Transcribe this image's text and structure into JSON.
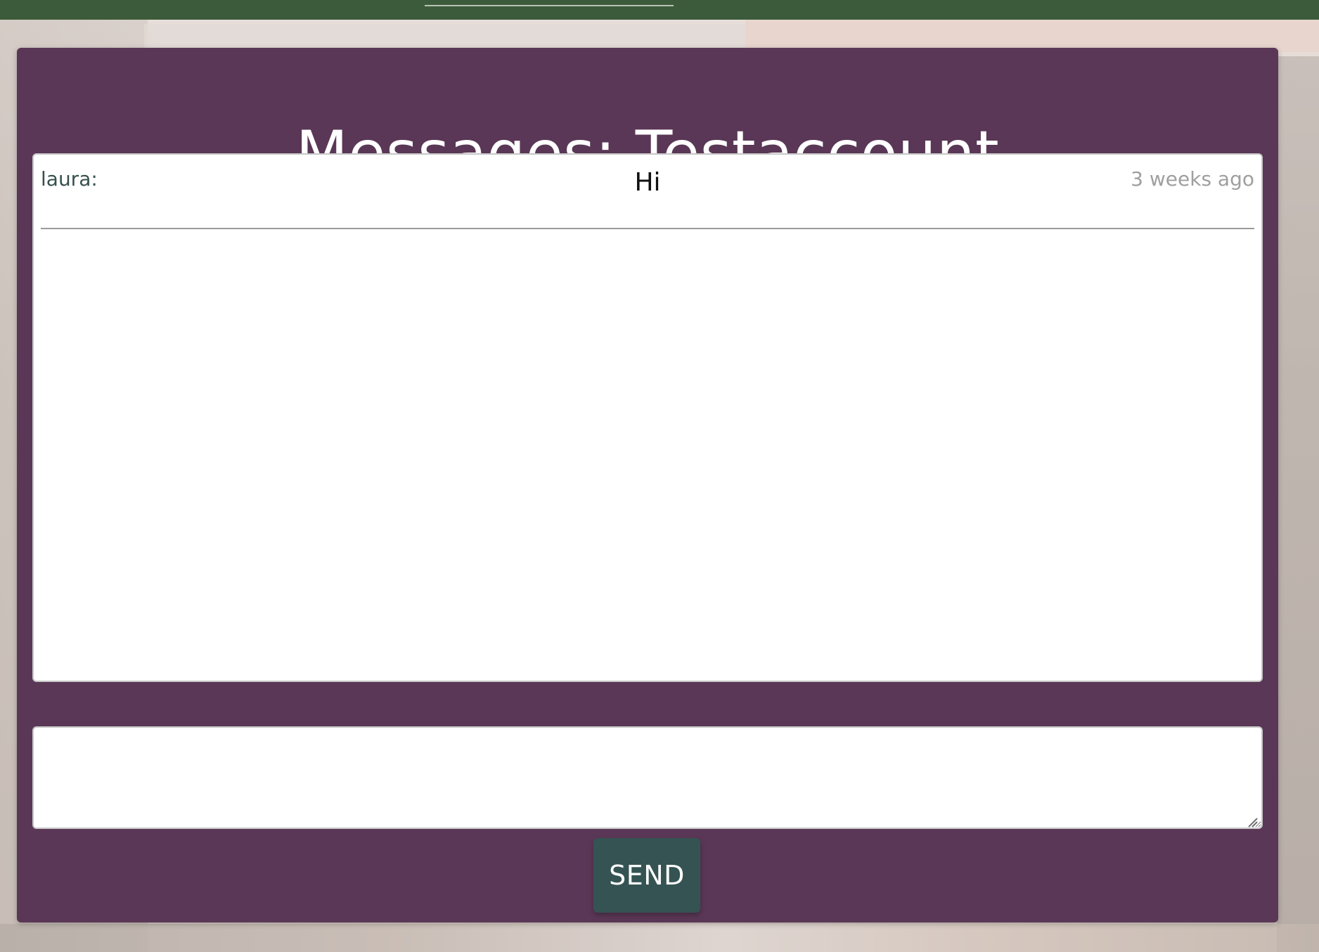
{
  "page": {
    "title": "Messages: Testaccount"
  },
  "messages": [
    {
      "sender": "laura:",
      "text": "Hi",
      "time": "3 weeks ago"
    }
  ],
  "composer": {
    "value": "",
    "placeholder": ""
  },
  "actions": {
    "send_label": "SEND"
  },
  "colors": {
    "top_bar": "#3c5b3a",
    "panel": "#5a3756",
    "button": "#355353",
    "sender": "#37504d",
    "time": "#9f9f9f"
  },
  "icons": {
    "resize": "resize-icon"
  }
}
